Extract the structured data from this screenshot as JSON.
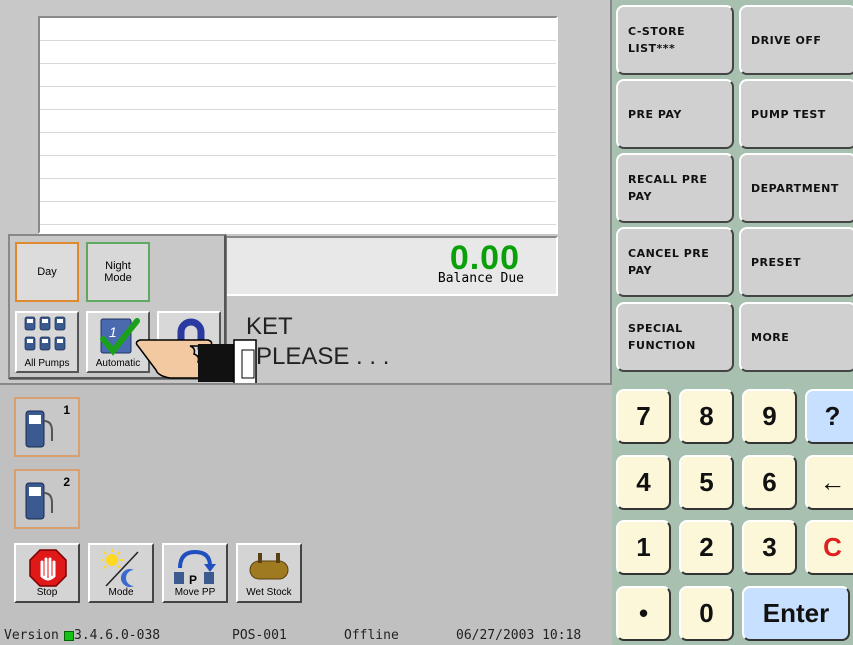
{
  "receipt": {
    "balance_amount": "0.00",
    "balance_label": "Balance Due"
  },
  "prompt": {
    "line1": "KET",
    "line2": "PLEASE . . ."
  },
  "popup": {
    "day_label": "Day",
    "night_label": "Night\nMode",
    "all_pumps_label": "All Pumps",
    "automatic_label": "Automatic",
    "third_label": "R"
  },
  "pumps": [
    {
      "number": "1"
    },
    {
      "number": "2"
    }
  ],
  "toolbar": {
    "stop": "Stop",
    "mode": "Mode",
    "move_pp": "Move PP",
    "wet_stock": "Wet Stock"
  },
  "status_bar": {
    "version_prefix": "Version",
    "version": "3.4.6.0-038",
    "terminal": "POS-001",
    "connection": "Offline",
    "datetime": "06/27/2003 10:18"
  },
  "function_buttons": [
    "C-STORE LIST***",
    "DRIVE OFF",
    "PRE PAY",
    "PUMP TEST",
    "RECALL PRE PAY",
    "DEPARTMENT",
    "CANCEL PRE PAY",
    "PRESET",
    "SPECIAL FUNCTION",
    "MORE"
  ],
  "keypad": [
    "7",
    "8",
    "9",
    "?",
    "4",
    "5",
    "6",
    "←",
    "1",
    "2",
    "3",
    "C",
    "•",
    "0",
    "Enter"
  ],
  "colors": {
    "balance": "#0aa00a",
    "clear_key": "#e02020",
    "right_panel": "#a8c0b0"
  }
}
